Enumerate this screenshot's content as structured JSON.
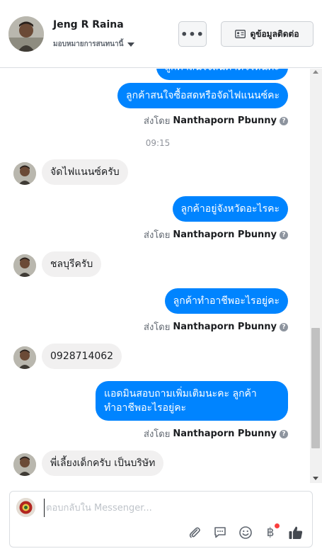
{
  "header": {
    "contact_name": "Jeng R Raina",
    "assignee_label": "มอบหมายการสนทนานี้",
    "more_label": "•••",
    "contact_info_label": "ดูข้อมูลติดต่อ"
  },
  "messages": {
    "cut_top_text": "ลูกค้าสนใจสินค้าตัวไหนคะ",
    "m1": "ลูกค้าสนใจซื้อสดหรือจัดไฟแนนซ์คะ",
    "sent_by_prefix": "ส่งโดย",
    "sender_name": "Nanthaporn Pbunny",
    "timestamp": "09:15",
    "m2": "จัดไฟแนนซ์ครับ",
    "m3": "ลูกค้าอยู่จังหวัดอะไรคะ",
    "m4": "ชลบุรีครับ",
    "m5": "ลูกค้าทำอาชีพอะไรอยู่คะ",
    "m6": "0928714062",
    "m7_line1": "แอดมินสอบถามเพิ่มเติมนะคะ ลูกค้า",
    "m7_line2": "ทำอาชีพอะไรอยู่คะ",
    "m8": "พี่เลี้ยงเด็กครับ เป็นบริษัท"
  },
  "composer": {
    "placeholder": "ตอบกลับใน Messenger...",
    "currency_symbol": "฿"
  },
  "colors": {
    "outgoing": "#0084ff",
    "incoming": "#f1f0f0",
    "like": "#444950",
    "badge": "#fa3e3e"
  }
}
